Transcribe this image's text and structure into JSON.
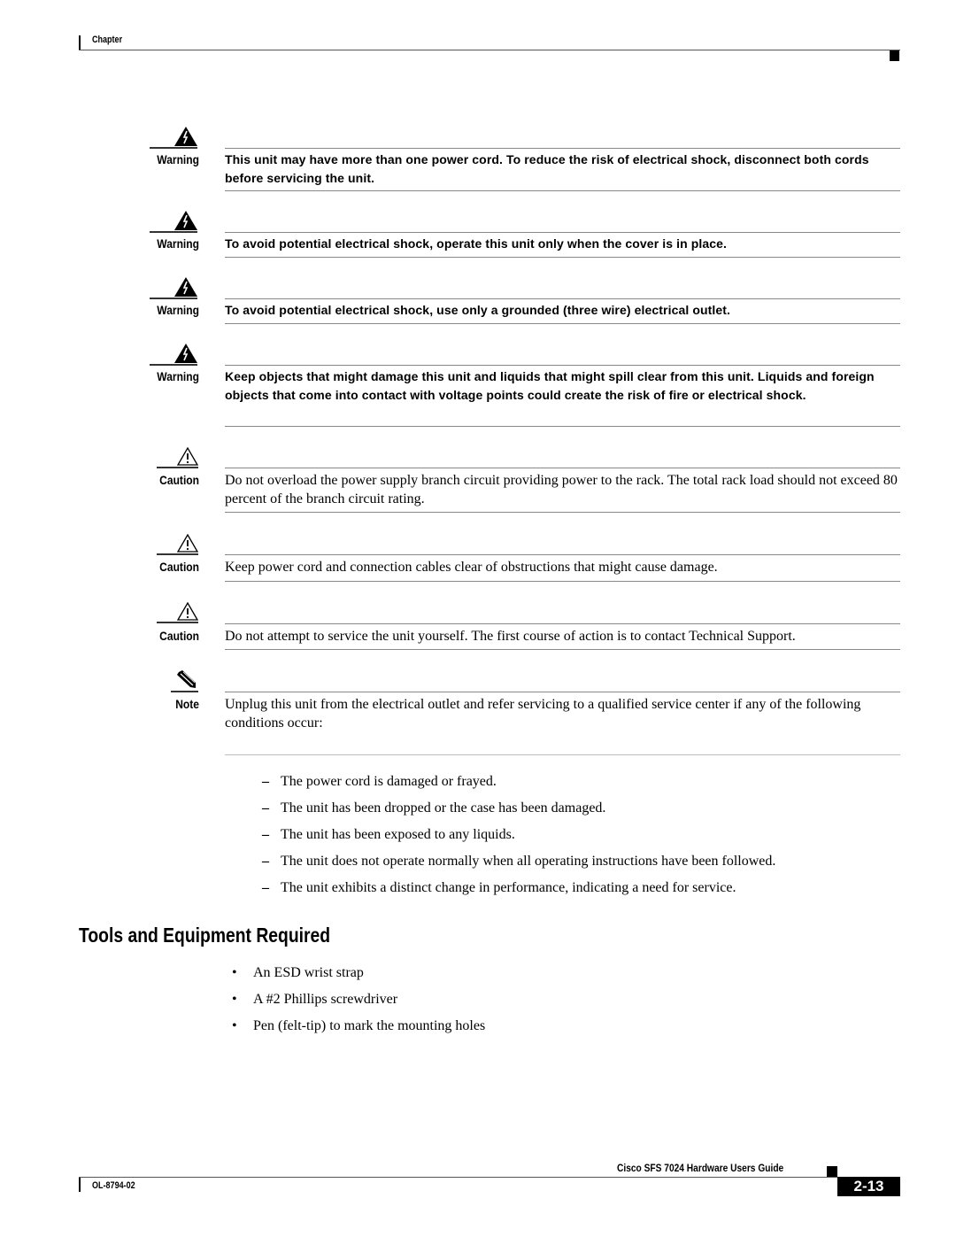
{
  "header": {
    "title": "Chapter"
  },
  "admonitions": [
    {
      "type": "warning",
      "icon": "warning-lightning-icon",
      "label": "Warning",
      "text": "This unit may have more than one power cord. To reduce the risk of electrical shock, disconnect both cords before servicing the unit."
    },
    {
      "type": "warning",
      "icon": "warning-lightning-icon",
      "label": "Warning",
      "text": "To avoid potential electrical shock, operate this unit only when the cover is in place."
    },
    {
      "type": "warning",
      "icon": "warning-lightning-icon",
      "label": "Warning",
      "text": "To avoid potential electrical shock, use only a grounded (three wire) electrical outlet."
    },
    {
      "type": "warning",
      "icon": "warning-lightning-icon",
      "label": "Warning",
      "text": "Keep objects that might damage this unit and liquids that might spill clear from this unit. Liquids and foreign objects that come into contact with voltage points could create the risk of fire or electrical shock."
    },
    {
      "type": "caution",
      "icon": "caution-exclamation-icon",
      "label": "Caution",
      "text": "Do not overload the power supply branch circuit providing power to the rack. The total rack load should not exceed 80 percent of the branch circuit rating."
    },
    {
      "type": "caution",
      "icon": "caution-exclamation-icon",
      "label": "Caution",
      "text": "Keep power cord and connection cables clear of obstructions that might cause damage."
    },
    {
      "type": "caution",
      "icon": "caution-exclamation-icon",
      "label": "Caution",
      "text": "Do not attempt to service the unit yourself. The first course of action is to contact Technical Support."
    },
    {
      "type": "note",
      "icon": "note-pencil-icon",
      "label": "Note",
      "text": "Unplug this unit from the electrical outlet and refer servicing to a qualified service center if any of the following conditions occur:"
    }
  ],
  "conditions": {
    "marker": "–",
    "items": [
      "The power cord is damaged or frayed.",
      "The unit has been dropped or the case has been damaged.",
      "The unit has been exposed to any liquids.",
      "The unit does not operate normally when all operating instructions have been followed.",
      "The unit exhibits a distinct change in performance, indicating a need for service."
    ]
  },
  "section": {
    "title": "Tools and Equipment Required",
    "marker": "•",
    "items": [
      "An ESD wrist strap",
      "A #2 Phillips screwdriver",
      "Pen (felt-tip) to mark the mounting holes"
    ]
  },
  "footer": {
    "guide_title": "Cisco SFS 7024 Hardware Users Guide",
    "doc_number": "OL-8794-02",
    "page_number": "2-13"
  }
}
